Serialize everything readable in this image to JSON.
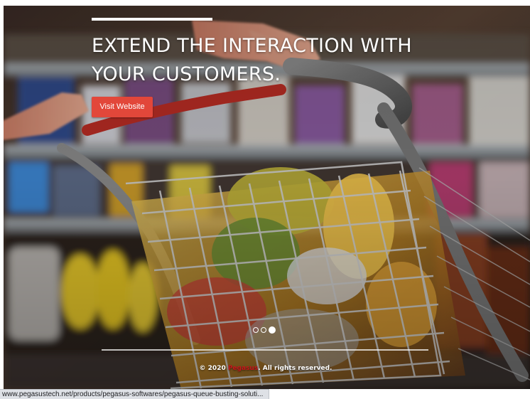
{
  "hero": {
    "title_line1": "EXTEND THE INTERACTION WITH",
    "title_line2": "YOUR CUSTOMERS.",
    "cta_label": "Visit Website",
    "background_image": "shopping-cart-in-supermarket-aisle"
  },
  "carousel": {
    "slide_count": 3,
    "active_index": 2
  },
  "footer": {
    "copyright_prefix": "© 2020",
    "brand": "Pegasus",
    "copyright_suffix": ". All rights reserved."
  },
  "status_bar": {
    "url": "www.pegasustech.net/products/pegasus-softwares/pegasus-queue-busting-soluti..."
  },
  "colors": {
    "accent": "#e2473a",
    "brand": "#c8151b"
  }
}
